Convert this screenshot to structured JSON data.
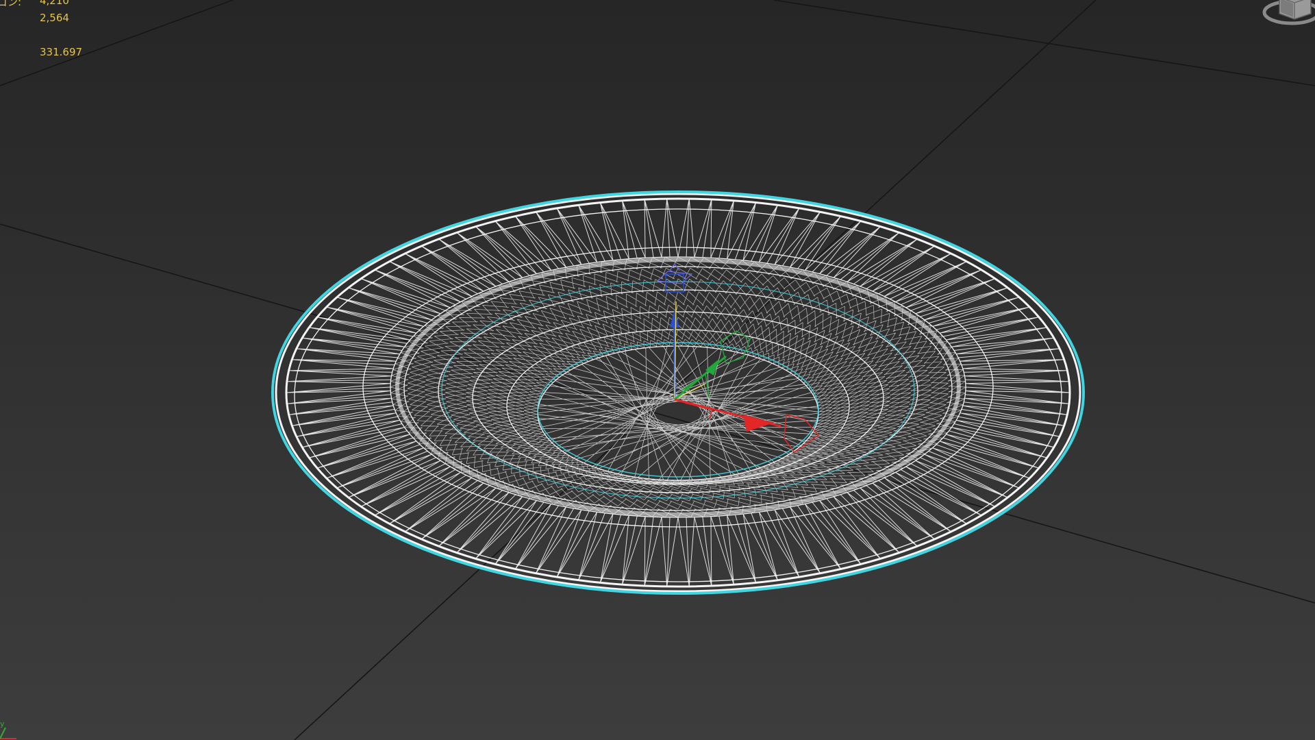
{
  "viewport": {
    "stats": [
      {
        "label": "ゴン:",
        "value": "4,210"
      },
      {
        "label": ":",
        "value": "2,564"
      },
      {
        "label": "",
        "value": "331.697"
      }
    ]
  },
  "object": {
    "type": "wireframe plate",
    "selected": true
  },
  "gizmo": {
    "x_color": "#e32626",
    "y_color": "#22a83a",
    "z_color": "#2a4fd8",
    "center_color": "#e8d84a"
  },
  "colors": {
    "background_top": "#272727",
    "background_bottom": "#3c3c3c",
    "grid_line": "#161616",
    "wire": "#ffffff",
    "selection": "#3fd6e2",
    "stats_text": "#e6c44a"
  }
}
